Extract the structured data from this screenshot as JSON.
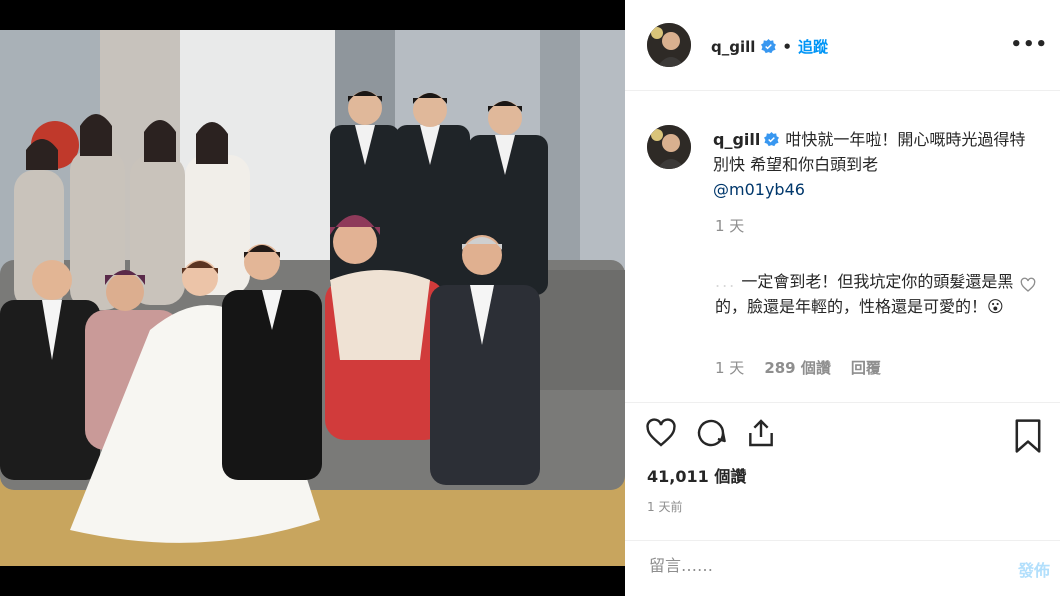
{
  "post": {
    "username": "q_gill",
    "follow_label": "追蹤",
    "more_label": "•••",
    "photo_alt": "wedding group photo"
  },
  "caption": {
    "username": "q_gill",
    "text": "咁快就一年啦！開心嘅時光過得特別快 希望和你白頭到老",
    "mention": "@m01yb46",
    "time": "1 天"
  },
  "comment": {
    "username": "...",
    "text": "一定會到老！但我坑定你的頭髮還是黑的，臉還是年輕的，性格還是可愛的！😮",
    "time": "1 天",
    "likes": "289 個讚",
    "reply_label": "回覆"
  },
  "actions": {
    "likes_count": "41,011 個讚",
    "time_ago": "1 天前"
  },
  "comment_box": {
    "placeholder": "留言……",
    "post_label": "發佈"
  },
  "colors": {
    "accent": "#0095f6",
    "verified": "#3897f0",
    "muted": "#8e8e8e"
  }
}
